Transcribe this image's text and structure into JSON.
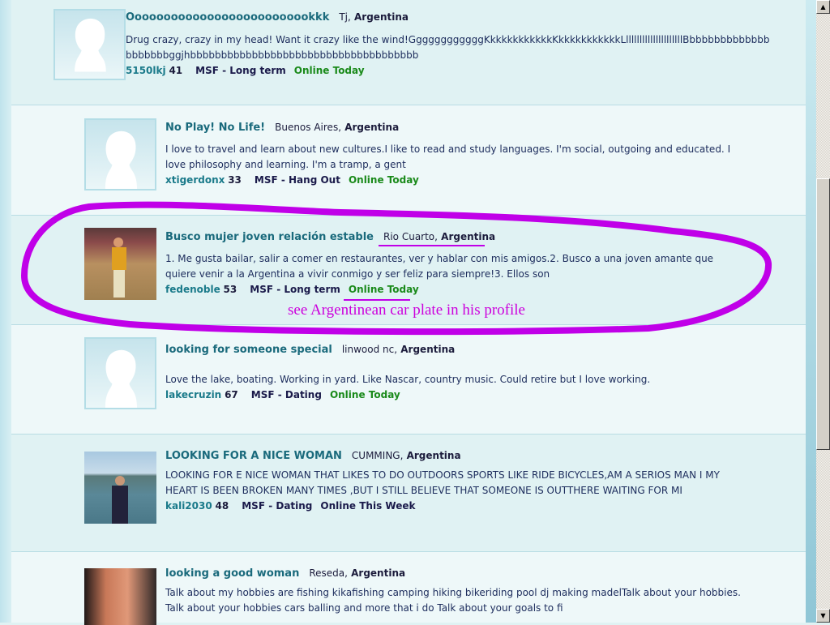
{
  "profiles": [
    {
      "title": "Oooooooooooooooooooooooookkk",
      "city": "Tj,",
      "country": "Argentina",
      "desc": "Drug crazy, crazy in my head! Want it crazy like the wind!GgggggggggggKkkkkkkkkkkkKkkkkkkkkkkkLlllllllllllllllllllllBbbbbbbbbbbbbbbbbbbbbggjhbbbbbbbbbbbbbbbbbbbbbbbbbbbbbbbbbbbbb",
      "user": "5150lkj",
      "age": "41",
      "msf": "MSF - Long term",
      "online": "Online Today",
      "photo": "silhouette-icon"
    },
    {
      "title": "No Play! No Life!",
      "city": "Buenos Aires,",
      "country": "Argentina",
      "desc": "I love to travel and learn about new cultures.I like to read and study languages. I'm social, outgoing and educated. I love philosophy and learning. I'm a tramp, a gent",
      "user": "xtigerdonx",
      "age": "33",
      "msf": "MSF - Hang Out",
      "online": "Online Today",
      "photo": "silhouette-icon"
    },
    {
      "title": "Busco mujer joven relación estable",
      "city": "Rio Cuarto,",
      "country": "Argentina",
      "desc": "1. Me gusta bailar, salir a comer en restaurantes, ver y hablar con mis amigos.2. Busco a una joven amante que quiere venir a la Argentina a vivir conmigo y ser feliz para siempre!3. Ellos son",
      "user": "fedenoble",
      "age": "53",
      "msf": "MSF - Long term",
      "online": "Online Today",
      "photo": "user-photo"
    },
    {
      "title": "looking for someone special",
      "city": "linwood nc,",
      "country": "Argentina",
      "desc": "Love the lake, boating. Working in yard. Like Nascar, country music. Could retire but I love working.",
      "user": "lakecruzin",
      "age": "67",
      "msf": "MSF - Dating",
      "online": "Online Today",
      "photo": "silhouette-icon"
    },
    {
      "title": "LOOKING FOR A NICE WOMAN",
      "city": "CUMMING,",
      "country": "Argentina",
      "desc": "LOOKING FOR E NICE WOMAN THAT LIKES TO DO OUTDOORS SPORTS LIKE RIDE BICYCLES,AM A SERIOS MAN I MY HEART IS BEEN BROKEN MANY TIMES ,BUT I STILL BELIEVE THAT SOMEONE IS OUTTHERE WAITING FOR MI",
      "user": "kali2030",
      "age": "48",
      "msf": "MSF - Dating",
      "online": "Online This Week",
      "photo": "user-photo"
    },
    {
      "title": "looking a good woman",
      "city": "Reseda,",
      "country": "Argentina",
      "desc": "Talk about my hobbies are fishing kikafishing camping hiking bikeriding pool dj making madelTalk about your hobbies. Talk about your hobbies cars balling and more that i do Talk about your goals to fi",
      "photo": "user-photo"
    }
  ],
  "annotation": {
    "text": "see Argentinean car plate in his profile",
    "color": "#c000e8"
  },
  "scrollbar": {
    "up": "▲",
    "down": "▼",
    "position": 0.35
  }
}
